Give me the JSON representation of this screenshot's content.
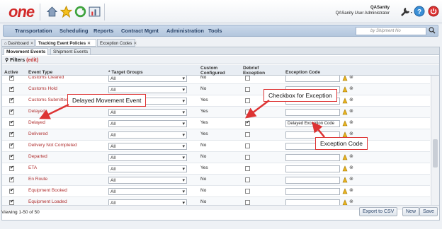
{
  "header": {
    "logo": "one",
    "user_name": "QASanity",
    "user_role": "QASanity User Administrator"
  },
  "nav": {
    "items": [
      "Transportation",
      "Scheduling",
      "Reports",
      "Contract Mgmt",
      "Administration",
      "Tools"
    ],
    "search_placeholder": "by Shipment No"
  },
  "tabs": [
    {
      "label": "Dashboard"
    },
    {
      "label": "Tracking Event Policies"
    },
    {
      "label": "Exception Codes"
    }
  ],
  "subtabs": [
    "Movement Events",
    "Shipment Events"
  ],
  "filters": {
    "label": "Filters",
    "edit": "(edit)"
  },
  "columns": {
    "active": "Active",
    "event_type": "Event Type",
    "target_groups": "* Target Groups",
    "custom_configured": "Custom Configured",
    "debrief_exception": "Debrief Exception",
    "exception_code": "Exception Code"
  },
  "rows": [
    {
      "event": "Customs Cleared",
      "group": "All",
      "custom": "No",
      "debrief": false,
      "code": ""
    },
    {
      "event": "Customs Hold",
      "group": "All",
      "custom": "No",
      "debrief": false,
      "code": ""
    },
    {
      "event": "Customs Submitted",
      "group": "All",
      "custom": "Yes",
      "debrief": false,
      "code": ""
    },
    {
      "event": "Delayed",
      "group": "All",
      "custom": "Yes",
      "debrief": false,
      "code": ""
    },
    {
      "event": "Delayed",
      "group": "All",
      "custom": "Yes",
      "debrief": true,
      "code": "Delayed Exception Code"
    },
    {
      "event": "Delivered",
      "group": "All",
      "custom": "Yes",
      "debrief": false,
      "code": ""
    },
    {
      "event": "Delivery Not Completed",
      "group": "All",
      "custom": "No",
      "debrief": false,
      "code": ""
    },
    {
      "event": "Departed",
      "group": "All",
      "custom": "No",
      "debrief": false,
      "code": ""
    },
    {
      "event": "ETA",
      "group": "All",
      "custom": "Yes",
      "debrief": false,
      "code": ""
    },
    {
      "event": "En Route",
      "group": "All",
      "custom": "No",
      "debrief": false,
      "code": ""
    },
    {
      "event": "Equipment Booked",
      "group": "All",
      "custom": "No",
      "debrief": false,
      "code": ""
    },
    {
      "event": "Equipment Loaded",
      "group": "All",
      "custom": "No",
      "debrief": false,
      "code": ""
    }
  ],
  "footer": {
    "viewing": "Viewing 1-50 of 50",
    "export": "Export to CSV",
    "new": "New",
    "save": "Save"
  },
  "callouts": {
    "delayed_event": "Delayed Movement Event",
    "checkbox": "Checkbox for Exception",
    "exception_code": "Exception Code"
  }
}
